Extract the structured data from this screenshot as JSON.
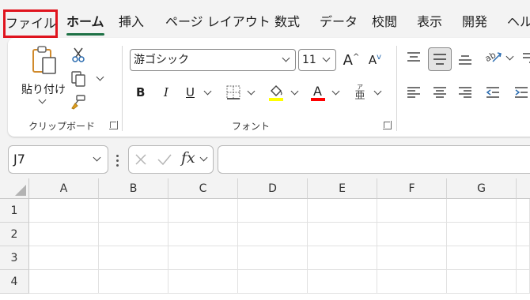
{
  "tabs": [
    {
      "label": "ファイル",
      "highlighted": true
    },
    {
      "label": "ホーム",
      "active": true
    },
    {
      "label": "挿入"
    },
    {
      "label": "ページ レイアウト"
    },
    {
      "label": "数式"
    },
    {
      "label": "データ"
    },
    {
      "label": "校閲"
    },
    {
      "label": "表示"
    },
    {
      "label": "開発"
    },
    {
      "label": "ヘル"
    }
  ],
  "ribbon": {
    "clipboard": {
      "paste_label": "貼り付け",
      "group_label": "クリップボード",
      "icons": [
        "paste-icon",
        "cut-icon",
        "copy-icon",
        "format-painter-icon"
      ]
    },
    "font": {
      "font_name": "游ゴシック",
      "font_size": "11",
      "group_label": "フォント",
      "bold": "B",
      "italic": "I",
      "underline": "U",
      "phonetic": "亜",
      "phonetic_ruby": "ア",
      "fill_color": "#ffff00",
      "font_color": "#ff0000"
    },
    "alignment": {
      "selected": "middle-align"
    }
  },
  "formula_bar": {
    "name_box": "J7",
    "fx_label": "fx",
    "content": ""
  },
  "sheet": {
    "columns": [
      "A",
      "B",
      "C",
      "D",
      "E",
      "F",
      "G"
    ],
    "rows": [
      "1",
      "2",
      "3",
      "4"
    ]
  },
  "colors": {
    "accent": "#1e7145",
    "highlight_box": "#e0141e"
  }
}
